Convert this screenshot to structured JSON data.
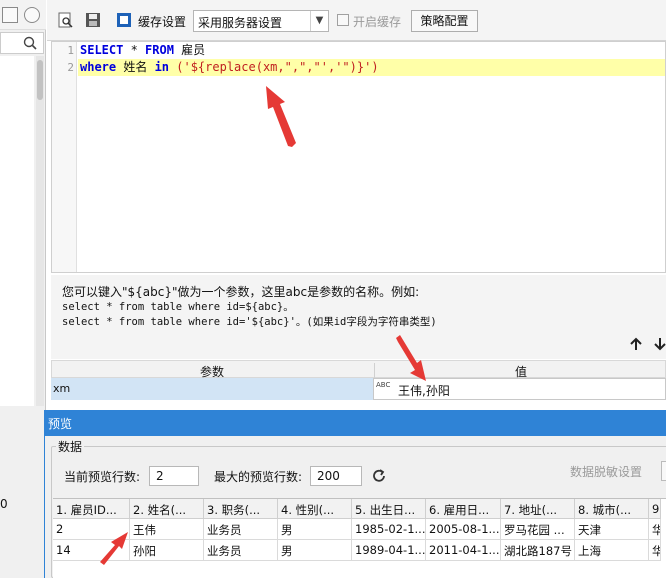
{
  "left_panel": {
    "partial_label": "0"
  },
  "toolbar": {
    "cache_label": "缓存设置",
    "cache_select_value": "采用服务器设置",
    "enable_cache_label": "开启缓存",
    "strategy_button_label": "策略配置"
  },
  "editor": {
    "lines": [
      {
        "no": "1",
        "kw1": "SELECT",
        "mid1": " * ",
        "kw2": "FROM",
        "rest": " 雇员"
      },
      {
        "no": "2",
        "kw1": "where",
        "mid1": " 姓名 ",
        "kw2": "in",
        "rest": " ('${replace(xm,\",\",\"','\")}')"
      }
    ]
  },
  "hint": {
    "line1": "您可以键入\"${abc}\"做为一个参数，这里abc是参数的名称。例如:",
    "line2": "select * from table where id=${abc}。",
    "line3": "select * from table where id='${abc}'。(如果id字段为字符串类型)"
  },
  "params": {
    "header_param": "参数",
    "header_value": "值",
    "rows": [
      {
        "name": "xm",
        "type_icon": "ABC",
        "value": "王伟,孙阳"
      }
    ]
  },
  "preview": {
    "title": "预览",
    "group_label": "数据",
    "current_rows_label": "当前预览行数:",
    "current_rows_value": "2",
    "max_rows_label": "最大的预览行数:",
    "max_rows_value": "200",
    "desensitize_label": "数据脱敏设置",
    "columns": [
      "1. 雇员ID...",
      "2. 姓名(...",
      "3. 职务(...",
      "4. 性别(...",
      "5. 出生日...",
      "6. 雇用日...",
      "7. 地址(...",
      "8. 城市(...",
      "9."
    ],
    "rows": [
      [
        "2",
        "王伟",
        "业务员",
        "男",
        "1985-02-1...",
        "2005-08-1...",
        "罗马花园 ...",
        "天津",
        "华"
      ],
      [
        "14",
        "孙阳",
        "业务员",
        "男",
        "1989-04-1...",
        "2011-04-1...",
        "湖北路187号",
        "上海",
        "华"
      ]
    ]
  },
  "colors": {
    "title_bar": "#2f83d6",
    "highlight_line": "#ffffa8",
    "arrow": "#e53935",
    "selected_row": "#d2e4f5"
  }
}
